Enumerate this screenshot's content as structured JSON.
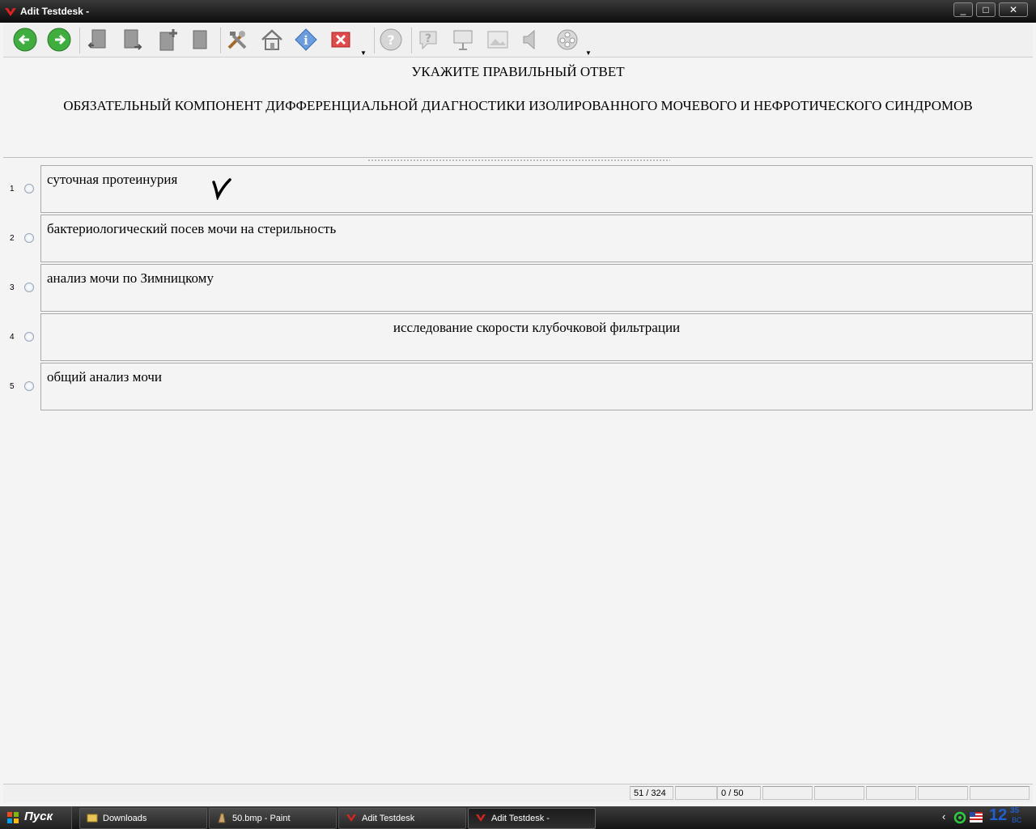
{
  "window": {
    "title": "Adit Testdesk -",
    "controls": [
      "_",
      "□",
      "✕"
    ]
  },
  "toolbar": {
    "icons": [
      "back-arrow-icon",
      "forward-arrow-icon",
      "book-back-icon",
      "book-forward-icon",
      "book-add-icon",
      "book-icon",
      "tools-icon",
      "home-icon",
      "info-icon",
      "close-red-icon",
      "help-icon",
      "hint-icon",
      "presentation-icon",
      "image-icon",
      "sound-icon",
      "video-icon"
    ]
  },
  "question": {
    "header": "УКАЖИТЕ ПРАВИЛЬНЫЙ ОТВЕТ",
    "text": "ОБЯЗАТЕЛЬНЫЙ КОМПОНЕНТ ДИФФЕРЕНЦИАЛЬНОЙ ДИАГНОСТИКИ ИЗОЛИРОВАННОГО МОЧЕВОГО И НЕФРОТИЧЕСКОГО СИНДРОМОВ"
  },
  "answers": [
    {
      "num": "1",
      "text": "суточная протеинурия",
      "checked_mark": "V"
    },
    {
      "num": "2",
      "text": "бактериологический посев мочи на стерильность"
    },
    {
      "num": "3",
      "text": "анализ мочи по Зимницкому"
    },
    {
      "num": "4",
      "text": "исследование скорости клубочковой фильтрации"
    },
    {
      "num": "5",
      "text": "общий анализ мочи"
    }
  ],
  "status": {
    "position": "51 / 324",
    "score": "0 / 50"
  },
  "taskbar": {
    "start": "Пуск",
    "tasks": [
      "Downloads",
      "50.bmp - Paint",
      "Adit Testdesk",
      "Adit Testdesk -"
    ],
    "clock_hour": "12",
    "clock_min": "35",
    "clock_day": "ВС"
  }
}
